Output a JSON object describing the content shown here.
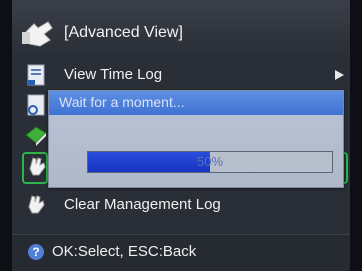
{
  "title": {
    "text": "[Advanced View]",
    "icon": "pointing-hand-icon"
  },
  "menu": {
    "items": [
      {
        "label": "View Time Log",
        "icon": "document-icon",
        "has_arrow": true
      },
      {
        "label": "",
        "icon": "document-magnifier-icon",
        "has_arrow": true
      },
      {
        "label": "",
        "icon": "green-book-icon",
        "has_arrow": true
      },
      {
        "label": "",
        "icon": "hand-icon",
        "selected": true
      },
      {
        "label": "Clear Management Log",
        "icon": "hand-icon"
      }
    ]
  },
  "dialog": {
    "message": "Wait for a moment...",
    "progress_label": "50%",
    "progress": 0.5
  },
  "footer": {
    "text": "OK:Select, ESC:Back",
    "icon": "info-icon",
    "icon_glyph": "?"
  },
  "colors": {
    "selection": "#2db54a",
    "progress": "#1633c0",
    "dialog_header": "#3f72d2"
  }
}
